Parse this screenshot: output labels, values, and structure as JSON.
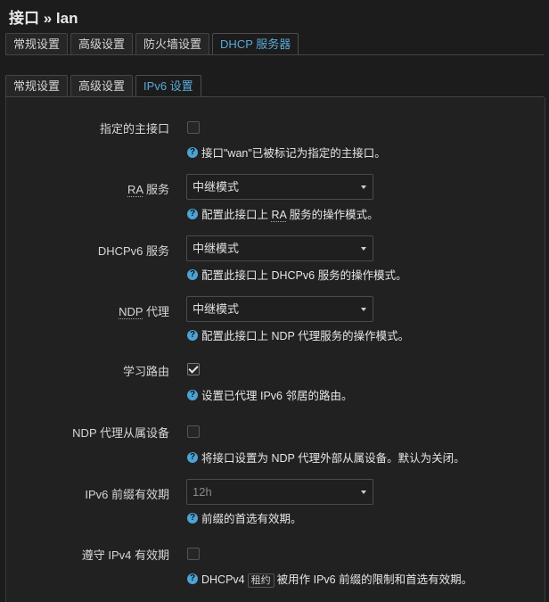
{
  "page_title": "接口 » lan",
  "main_tabs": [
    "常规设置",
    "高级设置",
    "防火墙设置",
    "DHCP 服务器"
  ],
  "sub_tabs": [
    "常规设置",
    "高级设置",
    "IPv6 设置"
  ],
  "rows": {
    "master": {
      "label": "指定的主接口",
      "checked": false,
      "help": "接口\"wan\"已被标记为指定的主接口。"
    },
    "ra": {
      "label_abbr": "RA",
      "label_rest": " 服务",
      "value": "中继模式",
      "help_pre": "配置此接口上 ",
      "help_abbr": "RA",
      "help_post": " 服务的操作模式。"
    },
    "dhcpv6": {
      "label": "DHCPv6 服务",
      "value": "中继模式",
      "help": "配置此接口上 DHCPv6 服务的操作模式。"
    },
    "ndp": {
      "label_abbr": "NDP",
      "label_rest": " 代理",
      "value": "中继模式",
      "help": "配置此接口上 NDP 代理服务的操作模式。"
    },
    "learn": {
      "label": "学习路由",
      "checked": true,
      "help": "设置已代理 IPv6 邻居的路由。"
    },
    "ndp_slave": {
      "label": "NDP 代理从属设备",
      "checked": false,
      "help": "将接口设置为 NDP 代理外部从属设备。默认为关闭。"
    },
    "ipv6_pref": {
      "label": "IPv6 前缀有效期",
      "value": "12h",
      "help": "前缀的首选有效期。"
    },
    "ipv4_life": {
      "label": "遵守 IPv4 有效期",
      "checked": false,
      "help_pre": "DHCPv4",
      "help_kbd": "租约",
      "help_post": "被用作 IPv6 前缀的限制和首选有效期。"
    }
  },
  "icons": {
    "help": "question-circle-icon",
    "caret": "chevron-down-icon",
    "check": "check-icon"
  },
  "colors": {
    "accent": "#5aa8d8",
    "help_icon": "#4ca3d6",
    "background": "#1c1c1c"
  }
}
